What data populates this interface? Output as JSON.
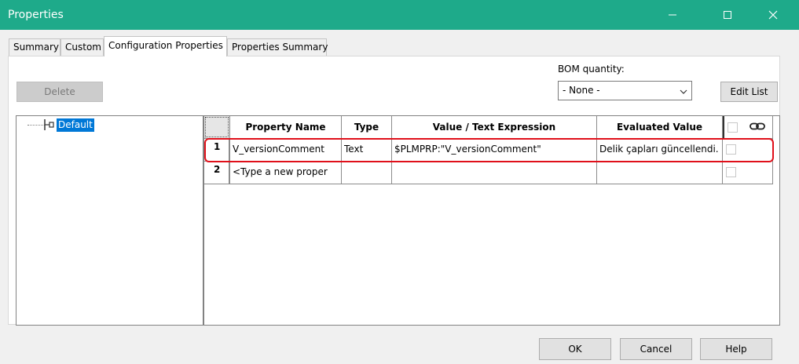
{
  "window": {
    "title": "Properties",
    "accent_color": "#1eaa8a",
    "controls": [
      "minimize-icon",
      "maximize-icon",
      "close-icon"
    ]
  },
  "tabs": [
    {
      "label": "Summary",
      "active": false
    },
    {
      "label": "Custom",
      "active": false
    },
    {
      "label": "Configuration Properties",
      "active": true
    },
    {
      "label": "Properties Summary",
      "active": false
    }
  ],
  "toolbar": {
    "delete_label": "Delete",
    "bom_label": "BOM quantity:",
    "bom_value": "- None -",
    "edit_list_label": "Edit List"
  },
  "tree": {
    "items": [
      {
        "label": "Default",
        "selected": true,
        "icon": "configuration-icon"
      }
    ]
  },
  "grid": {
    "columns": [
      "Property Name",
      "Type",
      "Value / Text Expression",
      "Evaluated Value"
    ],
    "header_icon": "link-icon",
    "rows": [
      {
        "num": "1",
        "name": "V_versionComment",
        "type": "Text",
        "value": "$PLMPRP:\"V_versionComment\"",
        "evaluated": "Delik çapları güncellendi.",
        "checked": false
      },
      {
        "num": "2",
        "name": "<Type a new proper",
        "type": "",
        "value": "",
        "evaluated": "",
        "checked": false
      }
    ],
    "highlight_color": "#e0101a"
  },
  "footer": {
    "ok_label": "OK",
    "cancel_label": "Cancel",
    "help_label": "Help"
  }
}
